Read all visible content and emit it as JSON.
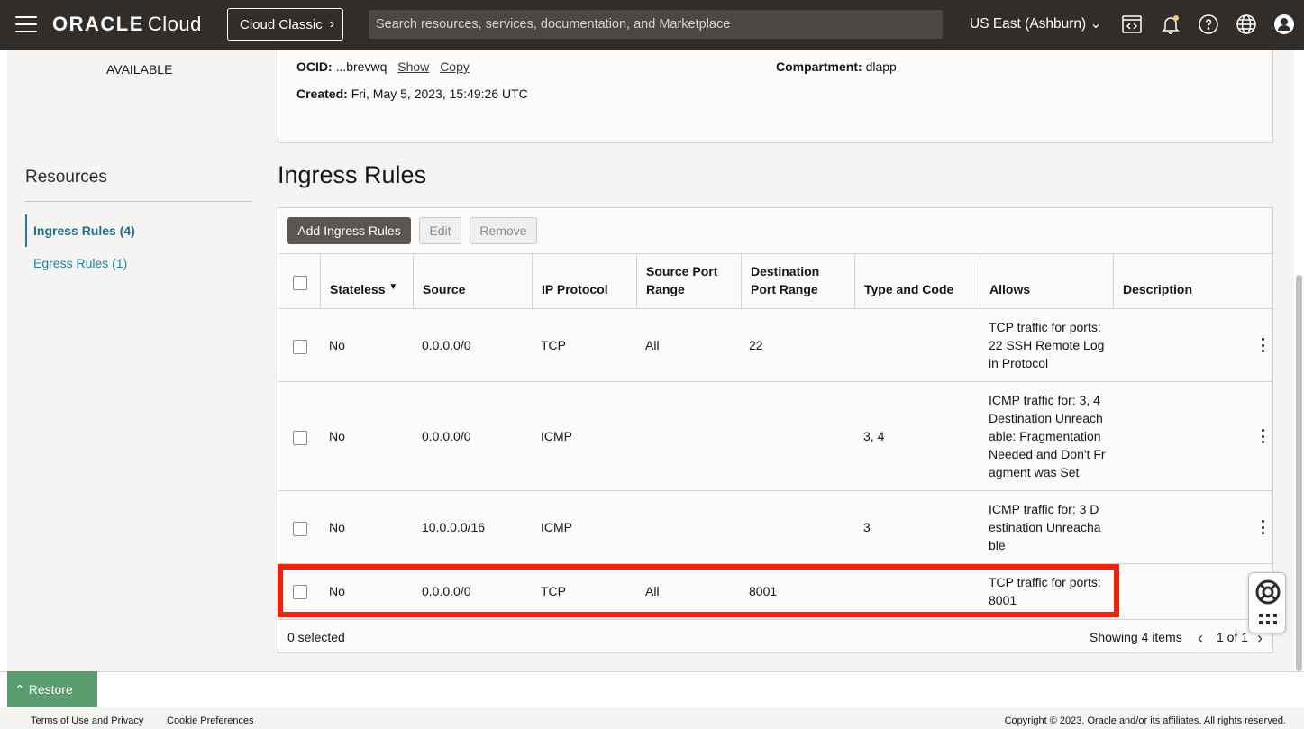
{
  "header": {
    "brand": "ORACLE",
    "product": "Cloud",
    "classic_button": "Cloud Classic",
    "search_placeholder": "Search resources, services, documentation, and Marketplace",
    "region": "US East (Ashburn)",
    "icons": [
      "code-editor-icon",
      "bell-icon",
      "help-icon",
      "globe-icon",
      "user-icon"
    ]
  },
  "left": {
    "status": "AVAILABLE",
    "resources_title": "Resources",
    "items": [
      {
        "label": "Ingress Rules (4)",
        "active": true
      },
      {
        "label": "Egress Rules (1)",
        "active": false
      }
    ]
  },
  "details": {
    "ocid_label": "OCID:",
    "ocid_value": "...brevwq",
    "show": "Show",
    "copy": "Copy",
    "created_label": "Created:",
    "created_value": "Fri, May 5, 2023, 15:49:26 UTC",
    "compartment_label": "Compartment:",
    "compartment_value": "dlapp"
  },
  "section_title": "Ingress Rules",
  "toolbar": {
    "add": "Add Ingress Rules",
    "edit": "Edit",
    "remove": "Remove"
  },
  "table": {
    "columns": [
      "Stateless",
      "Source",
      "IP Protocol",
      "Source Port Range",
      "Destination Port Range",
      "Type and Code",
      "Allows",
      "Description"
    ],
    "rows": [
      {
        "stateless": "No",
        "source": "0.0.0.0/0",
        "protocol": "TCP",
        "src_port": "All",
        "dst_port": "22",
        "type_code": "",
        "allows": "TCP traffic for ports: 22 SSH Remote Login Protocol",
        "description": ""
      },
      {
        "stateless": "No",
        "source": "0.0.0.0/0",
        "protocol": "ICMP",
        "src_port": "",
        "dst_port": "",
        "type_code": "3, 4",
        "allows": "ICMP traffic for: 3, 4 Destination Unreachable: Fragmentation Needed and Don't Fragment was Set",
        "description": ""
      },
      {
        "stateless": "No",
        "source": "10.0.0.0/16",
        "protocol": "ICMP",
        "src_port": "",
        "dst_port": "",
        "type_code": "3",
        "allows": "ICMP traffic for: 3 Destination Unreachable",
        "description": ""
      },
      {
        "stateless": "No",
        "source": "0.0.0.0/0",
        "protocol": "TCP",
        "src_port": "All",
        "dst_port": "8001",
        "type_code": "",
        "allows": "TCP traffic for ports: 8001",
        "description": ""
      }
    ],
    "selected_text": "0 selected",
    "showing_text": "Showing 4 items",
    "page_text": "1 of 1"
  },
  "restore": "Restore",
  "footer": {
    "terms": "Terms of Use and Privacy",
    "cookies": "Cookie Preferences",
    "copyright": "Copyright © 2023, Oracle and/or its affiliates. All rights reserved."
  },
  "colors": {
    "header_bg": "#312d2a",
    "link": "#227e9e",
    "highlight": "#f5210b",
    "restore": "#5a9c6d"
  }
}
